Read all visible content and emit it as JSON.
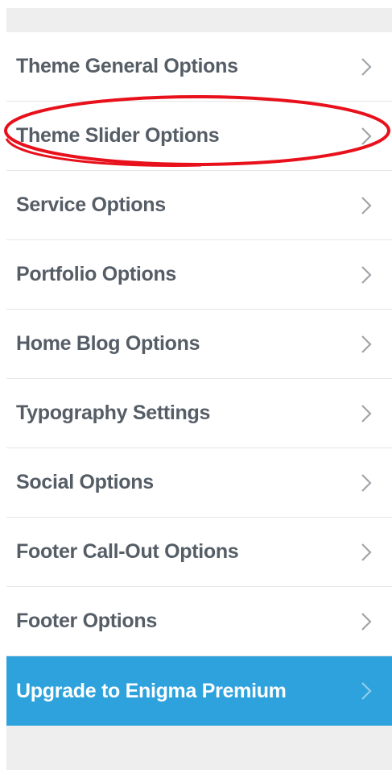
{
  "menu": {
    "items": [
      {
        "label": "Theme General Options",
        "icon": "chevron-right-icon"
      },
      {
        "label": "Theme Slider Options",
        "icon": "chevron-right-icon"
      },
      {
        "label": "Service Options",
        "icon": "chevron-right-icon"
      },
      {
        "label": "Portfolio Options",
        "icon": "chevron-right-icon"
      },
      {
        "label": "Home Blog Options",
        "icon": "chevron-right-icon"
      },
      {
        "label": "Typography Settings",
        "icon": "chevron-right-icon"
      },
      {
        "label": "Social Options",
        "icon": "chevron-right-icon"
      },
      {
        "label": "Footer Call-Out Options",
        "icon": "chevron-right-icon"
      },
      {
        "label": "Footer Options",
        "icon": "chevron-right-icon"
      }
    ],
    "premium": {
      "label": "Upgrade to Enigma Premium",
      "icon": "chevron-right-icon"
    }
  },
  "colors": {
    "panel_bg": "#eeeeee",
    "item_text": "#555d66",
    "chevron": "#a0a5aa",
    "premium_bg": "#2ea2dc",
    "annotation": "#e8101a"
  }
}
